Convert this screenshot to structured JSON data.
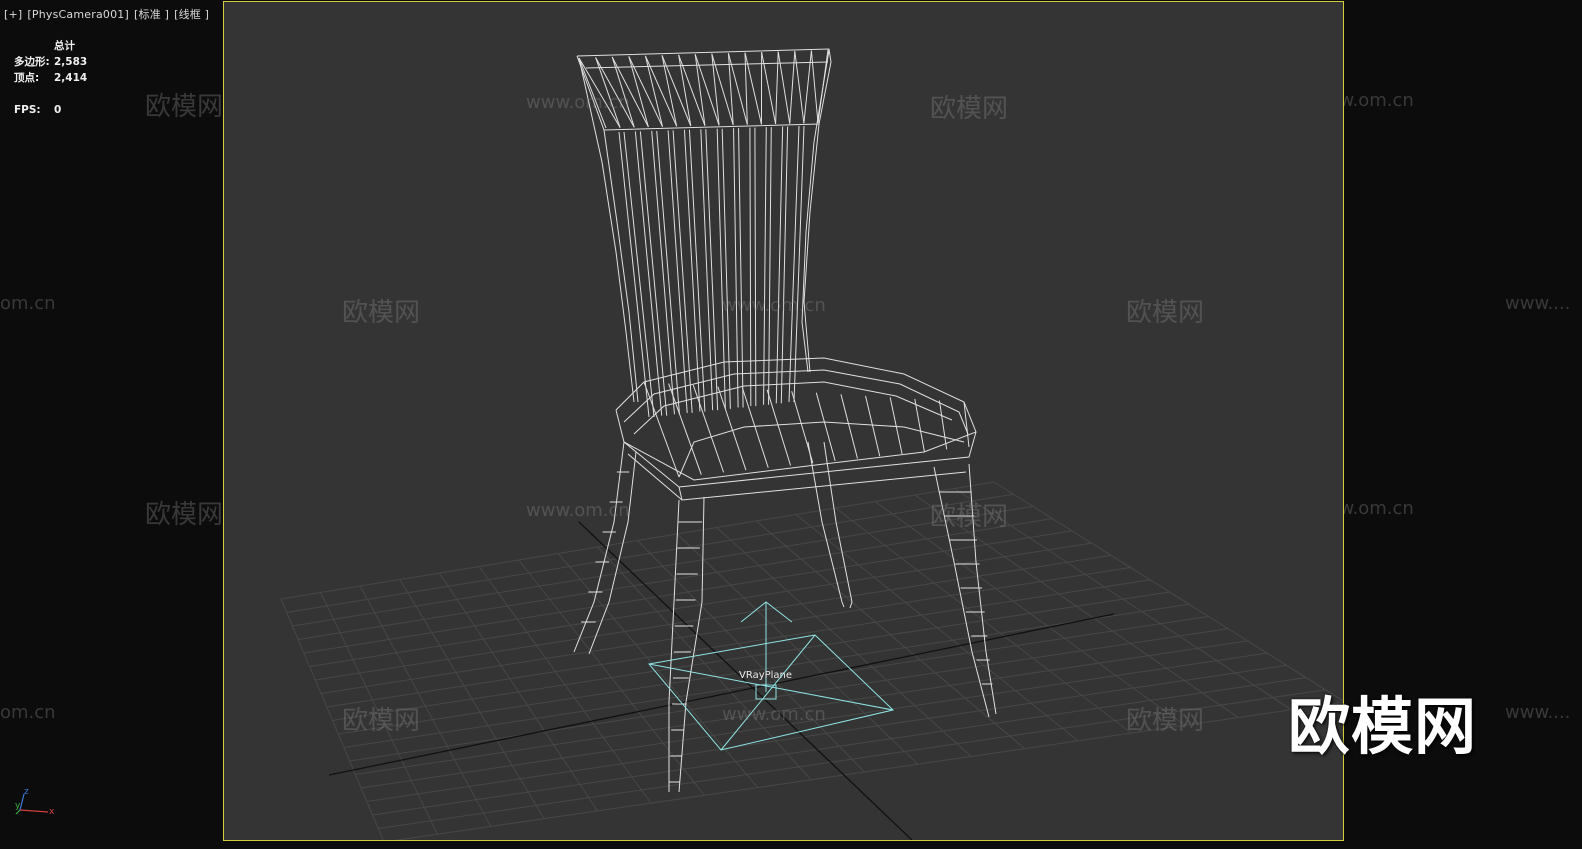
{
  "viewport_label": {
    "plus": "[+]",
    "camera": "[PhysCamera001]",
    "shading": "[标准 ]",
    "mode": "[线框 ]"
  },
  "stats": {
    "heading": "总计",
    "polygons_label": "多边形:",
    "polygons_value": "2,583",
    "vertices_label": "顶点:",
    "vertices_value": "2,414",
    "fps_label": "FPS:",
    "fps_value": "0"
  },
  "viewport": {
    "object_label": "VRayPlane",
    "border_color": "#d3cf3a",
    "background": "#343434",
    "gizmo_color": "#8fe3e3"
  },
  "watermark": {
    "brand": "欧模网",
    "url": "www.om.cn",
    "url_partial_left": "om.cn",
    "url_partial_right": "www...."
  },
  "logo_text": "欧模网",
  "axis_labels": {
    "z": "z",
    "y": "y",
    "x": "x"
  }
}
